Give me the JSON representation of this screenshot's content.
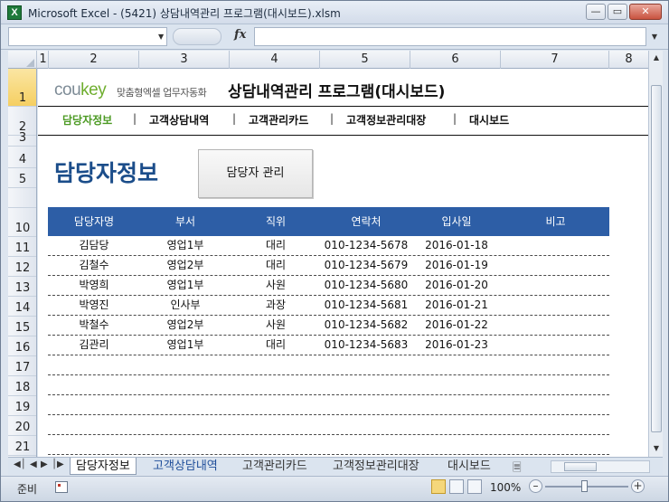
{
  "window": {
    "title": "Microsoft Excel - (5421) 상담내역관리 프로그램(대시보드).xlsm",
    "app_icon": "X"
  },
  "formula_bar": {
    "name_box_value": "",
    "fx_label": "fx",
    "formula_value": ""
  },
  "columns": [
    "1",
    "2",
    "3",
    "4",
    "5",
    "6",
    "7",
    "8"
  ],
  "rows": [
    "1",
    "2",
    "3",
    "4",
    "5",
    "",
    "10",
    "11",
    "12",
    "13",
    "14",
    "15",
    "16",
    "17",
    "18",
    "19",
    "20",
    "21"
  ],
  "sheet": {
    "logo_main": "cou",
    "logo_key": "key",
    "logo_sub": "맞춤형엑셀 업무자동화",
    "app_title": "상담내역관리 프로그램(대시보드)",
    "nav": [
      {
        "label": "담당자정보",
        "active": true
      },
      {
        "label": "고객상담내역",
        "active": false
      },
      {
        "label": "고객관리카드",
        "active": false
      },
      {
        "label": "고객정보관리대장",
        "active": false
      },
      {
        "label": "대시보드",
        "active": false
      }
    ],
    "nav_separator": "|",
    "page_heading": "담당자정보",
    "manage_button": "담당자 관리",
    "table": {
      "headers": [
        "담당자명",
        "부서",
        "직위",
        "연락처",
        "입사일",
        "비고"
      ],
      "rows": [
        [
          "김담당",
          "영업1부",
          "대리",
          "010-1234-5678",
          "2016-01-18",
          ""
        ],
        [
          "김철수",
          "영업2부",
          "대리",
          "010-1234-5679",
          "2016-01-19",
          ""
        ],
        [
          "박영희",
          "영업1부",
          "사원",
          "010-1234-5680",
          "2016-01-20",
          ""
        ],
        [
          "박영진",
          "인사부",
          "과장",
          "010-1234-5681",
          "2016-01-21",
          ""
        ],
        [
          "박철수",
          "영업2부",
          "사원",
          "010-1234-5682",
          "2016-01-22",
          ""
        ],
        [
          "김관리",
          "영업1부",
          "대리",
          "010-1234-5683",
          "2016-01-23",
          ""
        ],
        [
          "",
          "",
          "",
          "",
          "",
          ""
        ],
        [
          "",
          "",
          "",
          "",
          "",
          ""
        ],
        [
          "",
          "",
          "",
          "",
          "",
          ""
        ],
        [
          "",
          "",
          "",
          "",
          "",
          ""
        ],
        [
          "",
          "",
          "",
          "",
          "",
          ""
        ]
      ]
    }
  },
  "sheet_tabs": [
    {
      "label": "담당자정보",
      "active": true
    },
    {
      "label": "고객상담내역",
      "active": false
    },
    {
      "label": "고객관리카드",
      "active": false
    },
    {
      "label": "고객정보관리대장",
      "active": false
    },
    {
      "label": "대시보드",
      "active": false
    }
  ],
  "status": {
    "ready": "준비",
    "zoom": "100%"
  },
  "colors": {
    "table_header": "#2d5ea6",
    "heading": "#1b4d8a",
    "nav_active": "#4c9a23",
    "row_selected": "#f5cf62"
  }
}
